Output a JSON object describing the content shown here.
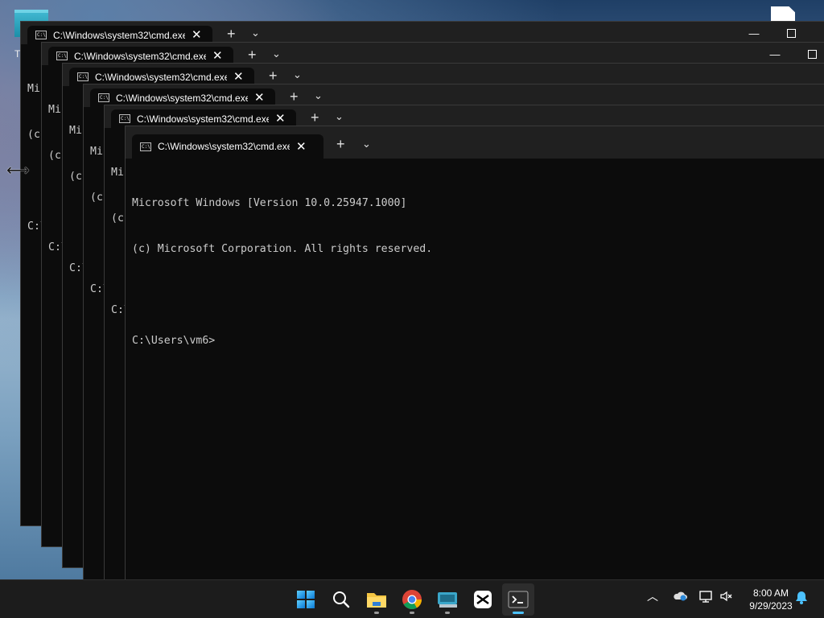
{
  "desktop": {
    "left_stub_text": "T"
  },
  "terminal": {
    "tab_title": "C:\\Windows\\system32\\cmd.exe",
    "new_tab": "+",
    "dropdown": "⌄",
    "minimize": "—",
    "close": "✕",
    "lines": [
      "Microsoft Windows [Version 10.0.25947.1000]",
      "(c) Microsoft Corporation. All rights reserved.",
      "",
      "C:\\Users\\vm6>"
    ]
  },
  "taskbar": {
    "apps": [
      {
        "name": "start-button",
        "icon": "windows-logo"
      },
      {
        "name": "search-button",
        "icon": "search-icon"
      },
      {
        "name": "file-explorer-button",
        "icon": "folder-icon"
      },
      {
        "name": "chrome-button",
        "icon": "chrome-icon"
      },
      {
        "name": "keyboard-app-button",
        "icon": "keyboard-icon"
      },
      {
        "name": "capcut-button",
        "icon": "capcut-icon"
      },
      {
        "name": "terminal-button",
        "icon": "terminal-icon"
      }
    ],
    "tray": {
      "chevron": "︿",
      "time": "8:00 AM",
      "date": "9/29/2023"
    }
  },
  "colors": {
    "accent": "#4cc2ff",
    "terminal_bg": "#0c0c0c",
    "titlebar_bg": "#202020",
    "taskbar_bg": "#1c1c1c"
  }
}
